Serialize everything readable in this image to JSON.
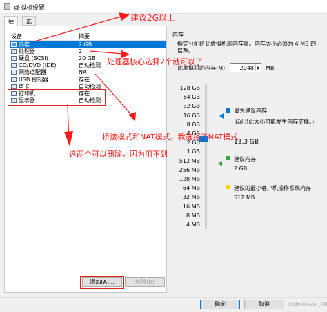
{
  "window": {
    "title": "虚拟机设置"
  },
  "tabs": [
    {
      "label": "硬件",
      "active": true
    },
    {
      "label": "选项",
      "active": false
    }
  ],
  "devices": {
    "header": {
      "device": "设备",
      "summary": "摘要"
    },
    "rows": [
      {
        "name": "内存",
        "summary": "2 GB",
        "icon": "memory-icon",
        "selected": true
      },
      {
        "name": "处理器",
        "summary": "2",
        "icon": "cpu-icon"
      },
      {
        "name": "硬盘 (SCSI)",
        "summary": "20 GB",
        "icon": "hard-disk-icon"
      },
      {
        "name": "CD/DVD (IDE)",
        "summary": "自动检测",
        "icon": "cd-icon"
      },
      {
        "name": "网络适配器",
        "summary": "NAT",
        "icon": "network-icon"
      },
      {
        "name": "USB 控制器",
        "summary": "存在",
        "icon": "usb-icon"
      },
      {
        "name": "声卡",
        "summary": "自动检测",
        "icon": "sound-icon"
      },
      {
        "name": "打印机",
        "summary": "存在",
        "icon": "printer-icon"
      },
      {
        "name": "显示器",
        "summary": "自动检测",
        "icon": "display-icon"
      }
    ],
    "add_button": "添加(A)...",
    "remove_button": "移除(R)"
  },
  "memory": {
    "section_title": "内存",
    "description": "指定分配给此虚拟机的内存量。内存大小必须为 4 MB 的倍数。",
    "field_label": "此虚拟机的内存(M):",
    "value": "2048",
    "unit": "MB",
    "scale_ticks": [
      "128 GB",
      "64 GB",
      "32 GB",
      "16 GB",
      "8 GB",
      "4 GB",
      "2 GB",
      "1 GB",
      "512 MB",
      "256 MB",
      "128 MB",
      "64 MB",
      "32 MB",
      "16 MB",
      "8 MB",
      "4 MB"
    ],
    "max_label": "最大建议内存",
    "max_note": "(超出此大小可能发生内存交换。)",
    "max_value": "13.3 GB",
    "rec_label": "建议内存",
    "rec_value": "2 GB",
    "min_label": "建议的最小客户机操作系统内存",
    "min_value": "512 MB",
    "colors": {
      "max": "#0078d7",
      "rec": "#3aa53a",
      "min": "#f2d500"
    }
  },
  "annotations": {
    "a1": "建议2G以上",
    "a2": "处理器核心选择2个就可以了",
    "a3": "桥接模式和NAT模式，我选择了NAT模式",
    "a4": "这两个可以删除，因为用不到",
    "color": "#ff1a1a"
  },
  "footer": {
    "ok": "确定",
    "cancel": "取消",
    "watermark": "CSDN @Coder_柠檬"
  }
}
